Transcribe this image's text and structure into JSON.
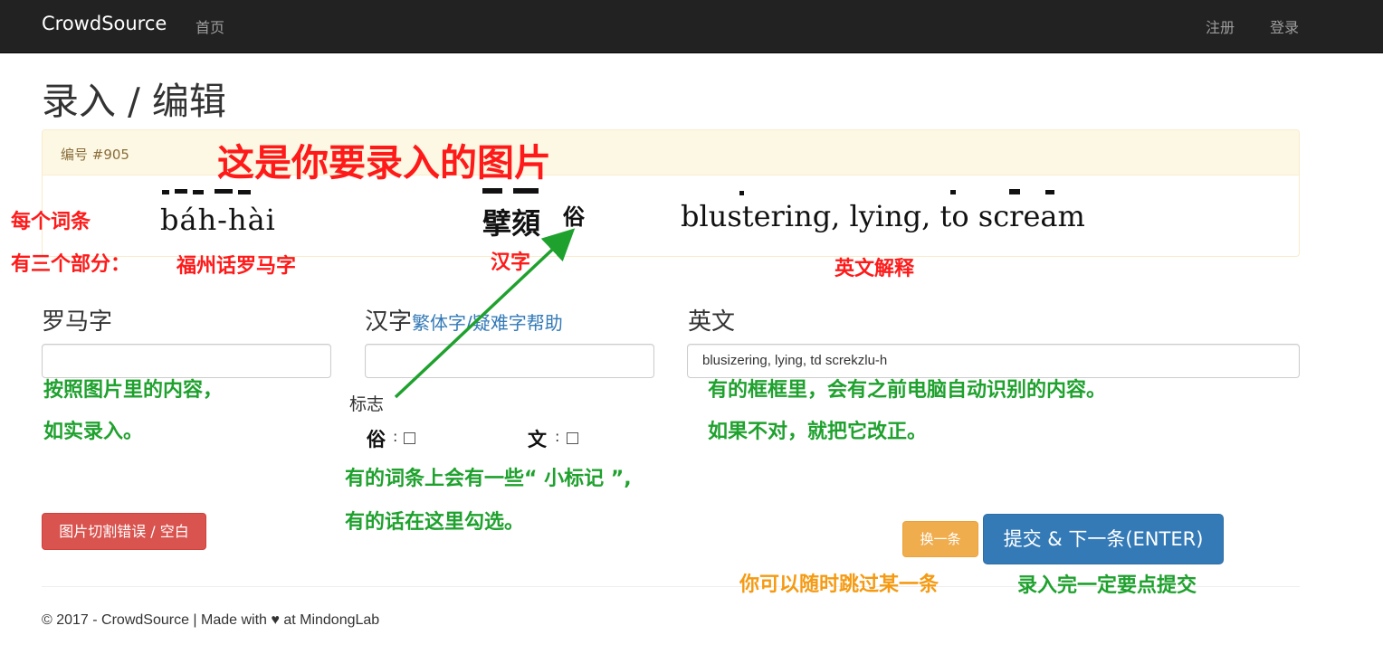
{
  "navbar": {
    "brand": "CrowdSource",
    "home": "首页",
    "register": "注册",
    "login": "登录"
  },
  "page": {
    "title": "录入 / 编辑"
  },
  "entry": {
    "id_label": "编号 #905",
    "scan": {
      "romanization": "báh-hài",
      "hanzi": "擘頦",
      "mark": "俗",
      "english": "blustering, lying, to scream"
    }
  },
  "form": {
    "roman_label": "罗马字",
    "roman_value": "",
    "hanzi_label": "汉字",
    "hanzi_help": "繁体字/疑难字帮助",
    "hanzi_value": "",
    "english_label": "英文",
    "english_value": "blusizering, lying, td screkzlu-h",
    "flags_label": "标志",
    "flags": [
      {
        "char": "俗",
        "colon": ":"
      },
      {
        "char": "文",
        "colon": ":"
      }
    ]
  },
  "buttons": {
    "report": "图片切割错误 / 空白",
    "skip": "换一条",
    "submit": "提交 & 下一条(ENTER)"
  },
  "footer": {
    "text": "© 2017 - CrowdSource | Made with ♥ at MindongLab"
  },
  "annotations": {
    "image_title": "这是你要录入的图片",
    "parts_line1": "每个词条",
    "parts_line2": "有三个部分：",
    "part_roman": "福州话罗马字",
    "part_hanzi": "汉字",
    "part_english": "英文解释",
    "roman_hint_1": "按照图片里的内容，",
    "roman_hint_2": "如实录入。",
    "english_hint_1": "有的框框里，会有之前电脑自动识别的内容。",
    "english_hint_2": "如果不对，就把它改正。",
    "flags_hint_1": "有的词条上会有一些“ 小标记 ”,",
    "flags_hint_2": "有的话在这里勾选。",
    "skip_hint": "你可以随时跳过某一条",
    "submit_hint": "录入完一定要点提交"
  },
  "colors": {
    "navbar": "#222222",
    "danger": "#d9534f",
    "warning": "#f0ad4e",
    "primary": "#337ab7",
    "annotation_red": "#ff1a1a",
    "annotation_green": "#1fa12e",
    "annotation_orange": "#f59a12"
  }
}
